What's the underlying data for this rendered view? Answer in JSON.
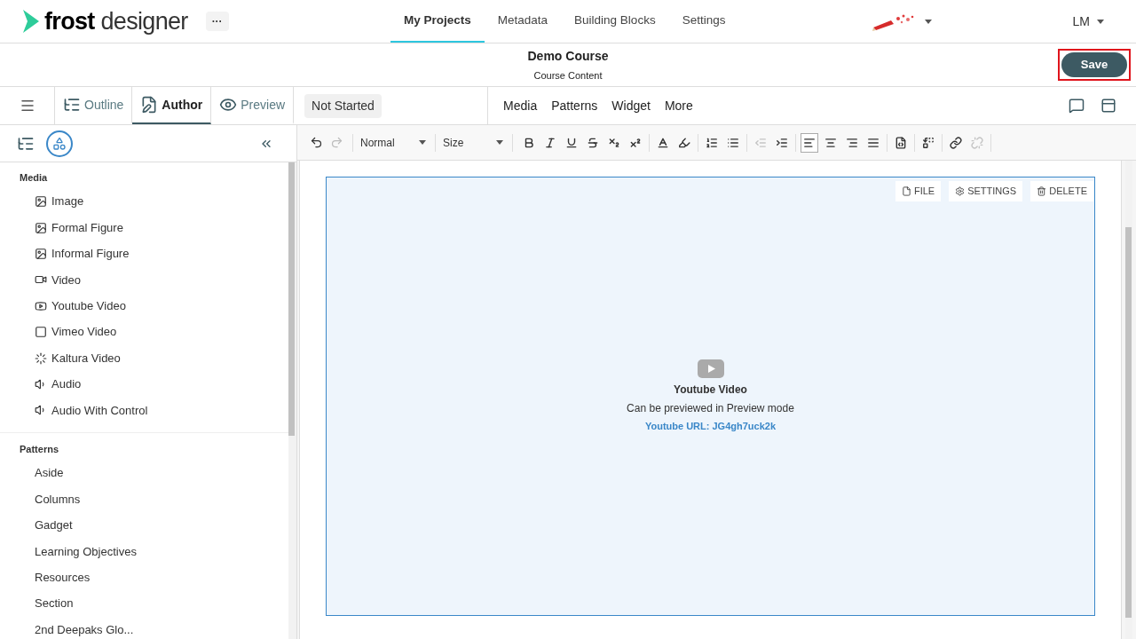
{
  "header": {
    "logo_bold": "frost",
    "logo_light": "designer",
    "more_button": "···",
    "nav": [
      {
        "label": "My Projects",
        "selected": true
      },
      {
        "label": "Metadata",
        "selected": false
      },
      {
        "label": "Building Blocks",
        "selected": false
      },
      {
        "label": "Settings",
        "selected": false
      }
    ],
    "user": "LM"
  },
  "course": {
    "title": "Demo Course",
    "subtitle": "Course Content",
    "save": "Save",
    "save_highlighted": true
  },
  "modes": [
    {
      "label": "Outline",
      "selected": false
    },
    {
      "label": "Author",
      "selected": true
    },
    {
      "label": "Preview",
      "selected": false
    }
  ],
  "status": "Not Started",
  "insert_menu": [
    "Media",
    "Patterns",
    "Widget",
    "More"
  ],
  "sidebar": {
    "groups": [
      {
        "title": "Media",
        "items": [
          "Image",
          "Formal Figure",
          "Informal Figure",
          "Video",
          "Youtube Video",
          "Vimeo Video",
          "Kaltura Video",
          "Audio",
          "Audio With Control"
        ]
      },
      {
        "title": "Patterns",
        "items": [
          "Aside",
          "Columns",
          "Gadget",
          "Learning Objectives",
          "Resources",
          "Section",
          "2nd Deepaks Glo..."
        ]
      }
    ]
  },
  "editor_toolbar": {
    "history": [
      {
        "disabled": false
      },
      {
        "disabled": true
      }
    ],
    "format": "Normal",
    "size": "Size",
    "buttons": [
      {
        "disabled": false,
        "selected": false
      },
      {
        "disabled": false,
        "selected": false
      },
      {
        "disabled": false,
        "selected": false
      },
      {
        "disabled": false,
        "selected": false
      },
      {
        "disabled": false,
        "selected": false
      },
      {
        "disabled": false,
        "selected": false
      },
      {
        "disabled": false,
        "selected": false
      },
      {
        "disabled": false,
        "selected": false
      },
      {
        "disabled": false,
        "selected": false
      },
      {
        "disabled": false,
        "selected": false
      },
      {
        "disabled": true,
        "selected": false
      },
      {
        "disabled": false,
        "selected": false
      },
      {
        "disabled": false,
        "selected": true
      },
      {
        "disabled": false,
        "selected": false
      },
      {
        "disabled": false,
        "selected": false
      },
      {
        "disabled": false,
        "selected": false
      },
      {
        "disabled": false,
        "selected": false
      },
      {
        "disabled": false,
        "selected": false
      },
      {
        "disabled": false,
        "selected": false
      },
      {
        "disabled": true,
        "selected": false
      }
    ]
  },
  "block": {
    "actions": [
      "FILE",
      "SETTINGS",
      "DELETE"
    ],
    "title": "Youtube Video",
    "note": "Can be previewed in Preview mode",
    "url": "Youtube URL: JG4gh7uck2k"
  }
}
